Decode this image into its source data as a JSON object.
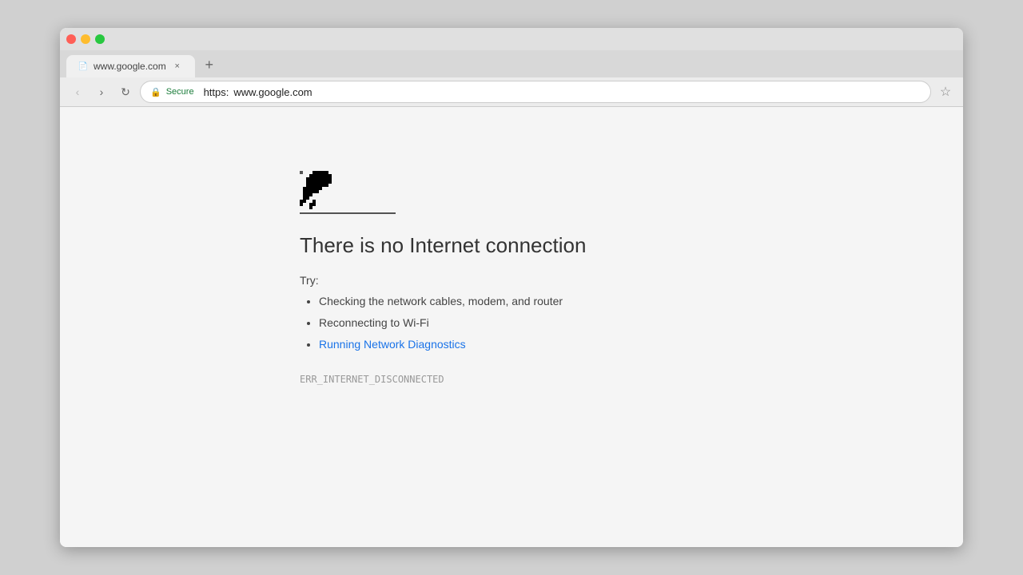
{
  "browser": {
    "tab": {
      "favicon": "📄",
      "title": "www.google.com",
      "close_label": "×"
    },
    "new_tab_label": "+",
    "nav": {
      "back_label": "‹",
      "forward_label": "›",
      "reload_label": "↻"
    },
    "address_bar": {
      "secure_label": "Secure",
      "url_prefix": "https:",
      "url_host": "www.google.com"
    },
    "bookmark_label": "☆"
  },
  "page": {
    "dino_alt": "Dinosaur offline game mascot",
    "error_title": "There is no Internet connection",
    "try_label": "Try:",
    "suggestions": [
      "Checking the network cables, modem, and router",
      "Reconnecting to Wi-Fi",
      "Running Network Diagnostics"
    ],
    "diagnostics_link": "Running Network Diagnostics",
    "error_code": "ERR_INTERNET_DISCONNECTED"
  }
}
